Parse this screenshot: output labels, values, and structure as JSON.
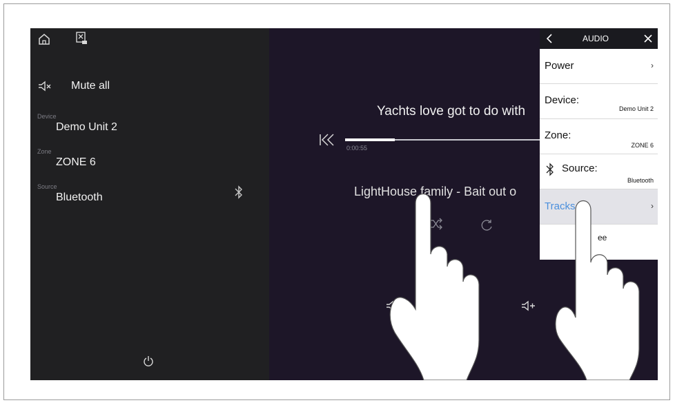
{
  "left_panel": {
    "mute_label": "Mute all",
    "device": {
      "label": "Device",
      "value": "Demo Unit 2"
    },
    "zone": {
      "label": "Zone",
      "value": "ZONE 6"
    },
    "source": {
      "label": "Source",
      "value": "Bluetooth"
    },
    "icons": [
      "home-icon",
      "waypoint-icon",
      "mute-icon",
      "bluetooth-icon",
      "power-icon"
    ]
  },
  "player": {
    "track_title": "Yachts love got to do with",
    "elapsed": "0:00:55",
    "artist": "LightHouse family - Bait out o",
    "progress": 0.25
  },
  "audio_menu": {
    "title": "AUDIO",
    "items": [
      {
        "label": "Power",
        "value": ""
      },
      {
        "label": "Device:",
        "value": "Demo Unit 2"
      },
      {
        "label": "Zone:",
        "value": "ZONE 6"
      },
      {
        "label": "Source:",
        "value": "Bluetooth"
      },
      {
        "label": "Tracks",
        "value": ""
      }
    ],
    "partial_text": "ee"
  },
  "colors": {
    "screen_bg": "#1c1a24",
    "main_bg": "#1d1628",
    "menu_highlight": "#e3e3e8",
    "accent": "#4a8fdd"
  }
}
